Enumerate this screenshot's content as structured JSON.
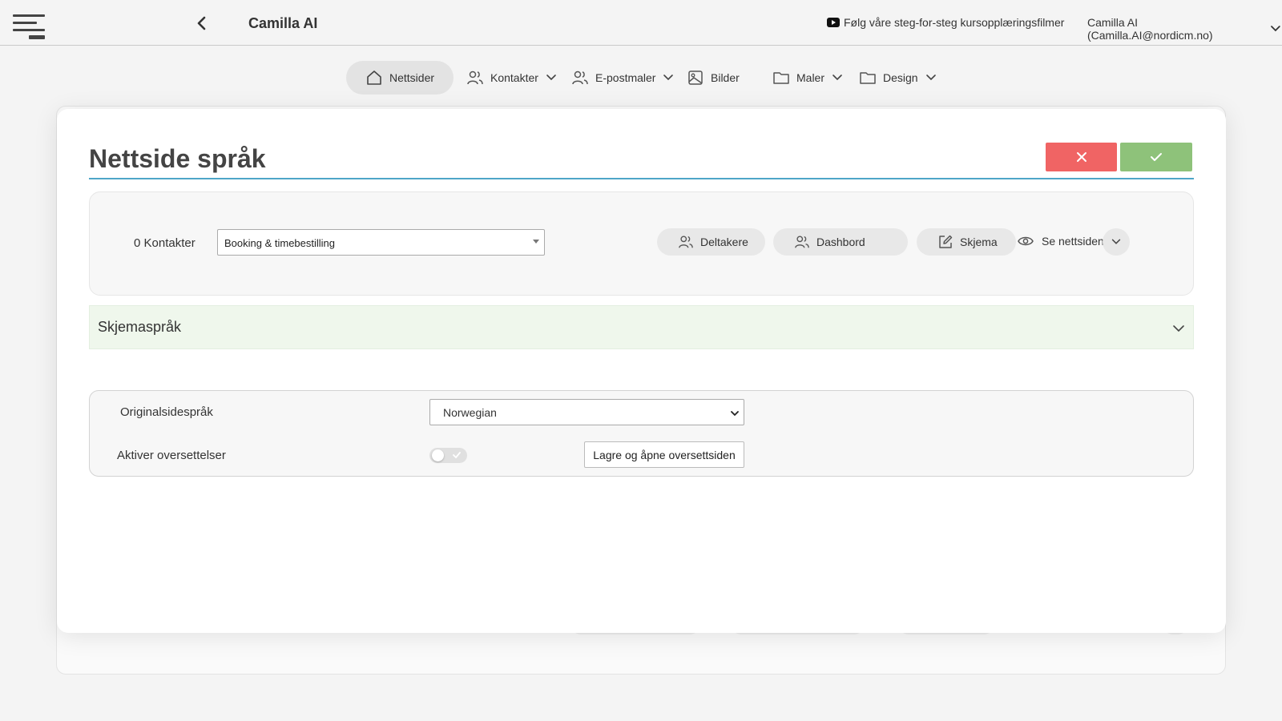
{
  "header": {
    "app_title": "Camilla AI",
    "tutorial_link": "Følg våre steg-for-steg kursopplæringsfilmer",
    "user_label": "Camilla AI (Camilla.AI@nordicm.no)"
  },
  "nav": {
    "items": [
      {
        "label": "Nettsider",
        "icon": "home-icon",
        "active": true
      },
      {
        "label": "Kontakter",
        "icon": "users-icon",
        "dropdown": true
      },
      {
        "label": "E-postmaler",
        "icon": "users-icon",
        "dropdown": true
      },
      {
        "label": "Bilder",
        "icon": "image-icon"
      },
      {
        "label": "Maler",
        "icon": "folder-icon",
        "dropdown": true
      },
      {
        "label": "Design",
        "icon": "folder-icon",
        "dropdown": true
      }
    ]
  },
  "modal": {
    "title": "Nettside språk",
    "toolbar": {
      "contacts_count": "0 Kontakter",
      "site_select_value": "Booking & timebestilling",
      "participants_label": "Deltakere",
      "dashboard_label": "Dashbord",
      "form_label": "Skjema",
      "view_site_label": "Se nettsiden"
    },
    "accordion": {
      "title": "Skjemaspråk"
    },
    "settings": {
      "original_language_label": "Originalsidespråk",
      "original_language_value": "Norwegian",
      "enable_translations_label": "Aktiver oversettelser",
      "enable_translations": false,
      "save_open_label": "Lagre og åpne oversettsiden"
    }
  },
  "colors": {
    "cancel": "#f06464",
    "confirm": "#8ec27a",
    "accent_line": "#4ea6c8",
    "accordion_bg": "#eff7ec"
  }
}
